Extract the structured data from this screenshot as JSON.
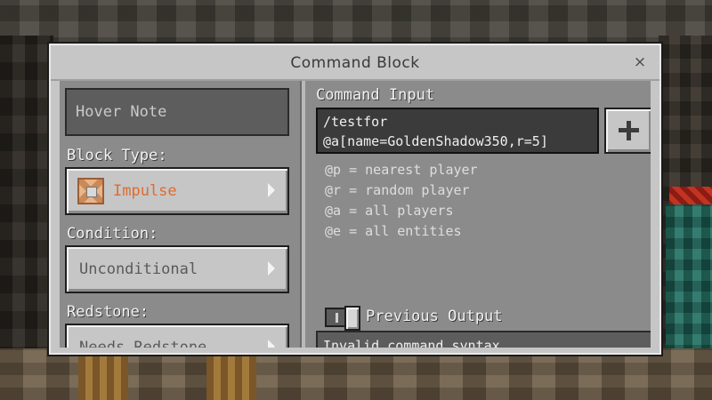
{
  "window": {
    "title": "Command Block",
    "close_symbol": "×"
  },
  "left": {
    "hover_note_placeholder": "Hover Note",
    "block_type_label": "Block Type:",
    "block_type_value": "Impulse",
    "condition_label": "Condition:",
    "condition_value": "Unconditional",
    "redstone_label": "Redstone:",
    "redstone_value": "Needs Redstone"
  },
  "right": {
    "command_input_label": "Command Input",
    "command_input_value": "/testfor\n@a[name=GoldenShadow350,r=5]",
    "hints": [
      "@p = nearest player",
      "@r = random player",
      "@a = all players",
      "@e = all entities"
    ],
    "previous_output_label": "Previous Output",
    "output_text": "Invalid command syntax"
  },
  "colors": {
    "accent_orange": "#e06b2d",
    "panel": "#8b8b8b",
    "dialog": "#c6c6c6"
  },
  "icons": {
    "block_type": "command-block-icon",
    "add": "plus-icon",
    "close": "close-icon"
  }
}
